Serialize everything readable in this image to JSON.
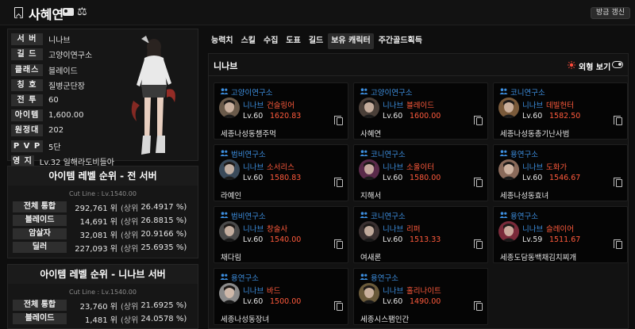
{
  "header": {
    "name": "사혜연",
    "refresh_button": "방금 갱신"
  },
  "profile": {
    "rows": [
      {
        "label": "서 버",
        "value": "니나브"
      },
      {
        "label": "길 드",
        "value": "고양이연구소"
      },
      {
        "label": "클래스",
        "value": "블레이드"
      },
      {
        "label": "칭 호",
        "value": "질병군단장"
      },
      {
        "label": "전 투",
        "value": "60"
      },
      {
        "label": "아이템",
        "value": "1,600.00"
      },
      {
        "label": "원정대",
        "value": "202"
      },
      {
        "label": "P V P",
        "value": "5단"
      },
      {
        "label": "영 지",
        "value": "Lv.32 일해라도비들아"
      }
    ]
  },
  "rank_all": {
    "title": "아이템 레벨 순위 - 전 서버",
    "cutline": "Cut Line : Lv.1540.00",
    "rows": [
      {
        "label": "전체 통합",
        "count": "292,761 위",
        "paren": "(상위",
        "pct": "26.4917 %)"
      },
      {
        "label": "블레이드",
        "count": "14,691 위",
        "paren": "(상위",
        "pct": "26.8815 %)"
      },
      {
        "label": "암살자",
        "count": "32,081 위",
        "paren": "(상위",
        "pct": "20.9166 %)"
      },
      {
        "label": "딜러",
        "count": "227,093 위",
        "paren": "(상위",
        "pct": "25.6935 %)"
      }
    ]
  },
  "rank_server": {
    "title": "아이템 레벨 순위 - 니나브 서버",
    "cutline": "Cut Line : Lv.1540.00",
    "rows": [
      {
        "label": "전체 통합",
        "count": "23,760 위",
        "paren": "(상위",
        "pct": "21.6925 %)"
      },
      {
        "label": "블레이드",
        "count": "1,481 위",
        "paren": "(상위",
        "pct": "24.0578 %)"
      }
    ]
  },
  "tabs": [
    "능력치",
    "스킬",
    "수집",
    "도표",
    "길드",
    "보유 캐릭터",
    "주간골드획득"
  ],
  "active_tab": 5,
  "content": {
    "server_title": "니나브",
    "view_toggle_label": "외형 보기"
  },
  "characters": [
    {
      "guild": "고양이연구소",
      "server": "니나브",
      "class": "건슬링어",
      "lv": "Lv.60",
      "ilvl": "1620.83",
      "name": "세종나성동챔주먹",
      "tone": "#6a5a4a"
    },
    {
      "guild": "고양이연구소",
      "server": "니나브",
      "class": "블레이드",
      "lv": "Lv.60",
      "ilvl": "1600.00",
      "name": "사혜연",
      "tone": "#4a3f38"
    },
    {
      "guild": "코니연구소",
      "server": "니나브",
      "class": "데빌헌터",
      "lv": "Lv.60",
      "ilvl": "1582.50",
      "name": "세종나성동총기난사범",
      "tone": "#7a5a3a"
    },
    {
      "guild": "범비연구소",
      "server": "니나브",
      "class": "소서리스",
      "lv": "Lv.60",
      "ilvl": "1580.83",
      "name": "라예인",
      "tone": "#3a4a5a"
    },
    {
      "guild": "코니연구소",
      "server": "니나브",
      "class": "소울이터",
      "lv": "Lv.60",
      "ilvl": "1580.00",
      "name": "지해서",
      "tone": "#5a2a4a"
    },
    {
      "guild": "용연구소",
      "server": "니나브",
      "class": "도화가",
      "lv": "Lv.60",
      "ilvl": "1546.67",
      "name": "세종나성동효녀",
      "tone": "#8a6a5a"
    },
    {
      "guild": "범비연구소",
      "server": "니나브",
      "class": "창술사",
      "lv": "Lv.60",
      "ilvl": "1540.00",
      "name": "채다림",
      "tone": "#4a4a4a"
    },
    {
      "guild": "코니연구소",
      "server": "니나브",
      "class": "리퍼",
      "lv": "Lv.60",
      "ilvl": "1513.33",
      "name": "여새론",
      "tone": "#3a3030"
    },
    {
      "guild": "용연구소",
      "server": "니나브",
      "class": "슬레이어",
      "lv": "Lv.59",
      "ilvl": "1511.67",
      "name": "세종도담동백채김치찌개",
      "tone": "#7a2a3a"
    },
    {
      "guild": "용연구소",
      "server": "니나브",
      "class": "바드",
      "lv": "Lv.60",
      "ilvl": "1500.00",
      "name": "세종나성동장녀",
      "tone": "#8a8a8a"
    },
    {
      "guild": "용연구소",
      "server": "니나브",
      "class": "홀리나이트",
      "lv": "Lv.60",
      "ilvl": "1490.00",
      "name": "세종시스팸인간",
      "tone": "#6a5a3a"
    }
  ],
  "colors": {
    "accent_blue": "#3d8fe0",
    "accent_red": "#ff5a3c"
  }
}
